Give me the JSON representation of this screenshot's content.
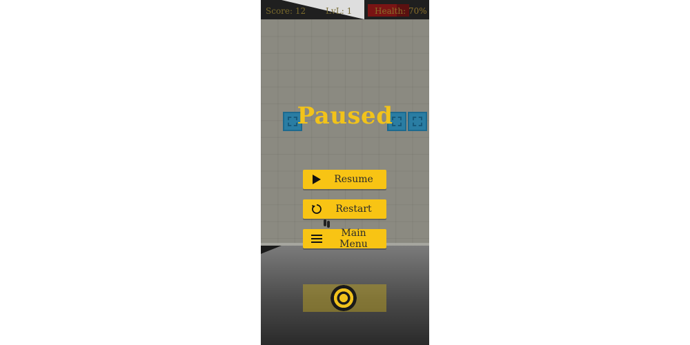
{
  "hud": {
    "score": "Score: 12",
    "level": "LvL: 1",
    "health": "Health: 70%",
    "health_value": 0.7
  },
  "pause_menu": {
    "title": "Paused",
    "buttons": [
      {
        "label": "Resume",
        "icon": "play-icon"
      },
      {
        "label": "Restart",
        "icon": "restart-icon"
      },
      {
        "label": "Main Menu",
        "icon": "menu-icon"
      }
    ]
  },
  "colors": {
    "accent": "#f8c414",
    "title": "#f2c31a",
    "block": "#2a7da3",
    "health_bar": "#7a1414"
  },
  "controls": {
    "joystick_icon": "joystick-knob"
  }
}
